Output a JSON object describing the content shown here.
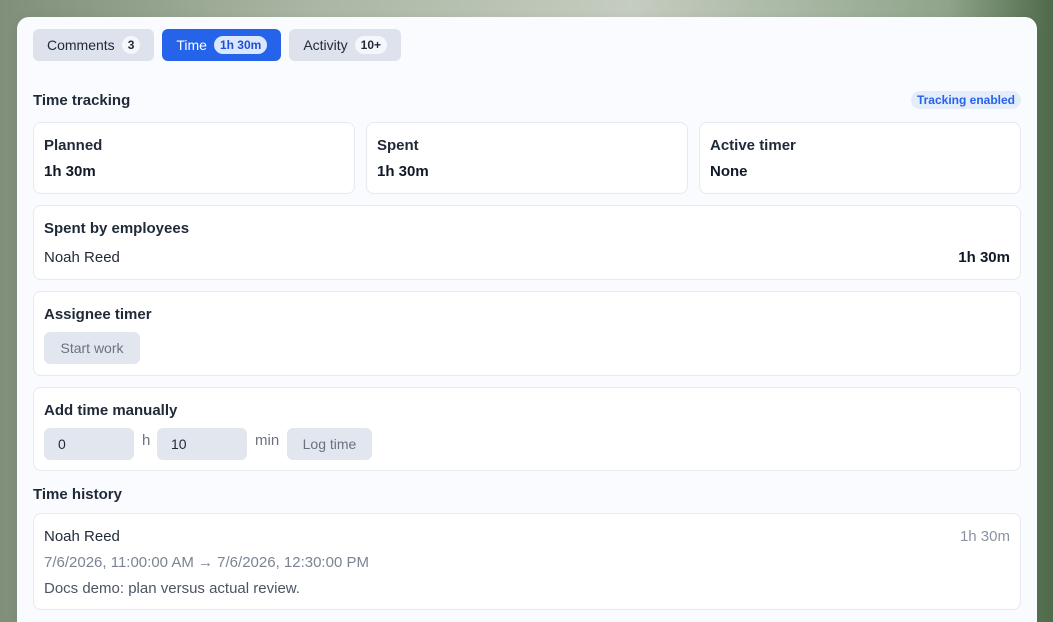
{
  "tabs": [
    {
      "label": "Comments",
      "count": "3"
    },
    {
      "label": "Time",
      "count": "1h 30m"
    },
    {
      "label": "Activity",
      "count": "10+"
    }
  ],
  "time_tracking": {
    "title": "Time tracking",
    "status_badge": "Tracking enabled",
    "stats": [
      {
        "label": "Planned",
        "value": "1h 30m"
      },
      {
        "label": "Spent",
        "value": "1h 30m"
      },
      {
        "label": "Active timer",
        "value": "None"
      }
    ]
  },
  "spent_by_employees": {
    "title": "Spent by employees",
    "rows": [
      {
        "name": "Noah Reed",
        "time": "1h 30m"
      }
    ]
  },
  "assignee_timer": {
    "title": "Assignee timer",
    "start_label": "Start work"
  },
  "manual_time": {
    "title": "Add time manually",
    "hours_value": "0",
    "hours_unit": "h",
    "minutes_value": "10",
    "minutes_unit": "min",
    "log_label": "Log time"
  },
  "history": {
    "title": "Time history",
    "entries": [
      {
        "name": "Noah Reed",
        "duration": "1h 30m",
        "range": "7/6/2026, 11:00:00 AM → 7/6/2026, 12:30:00 PM",
        "note": "Docs demo: plan versus actual review."
      }
    ]
  },
  "colors": {
    "accent": "#2563eb",
    "panel": "#fafbfe",
    "muted_button": "#e2e6ee"
  }
}
